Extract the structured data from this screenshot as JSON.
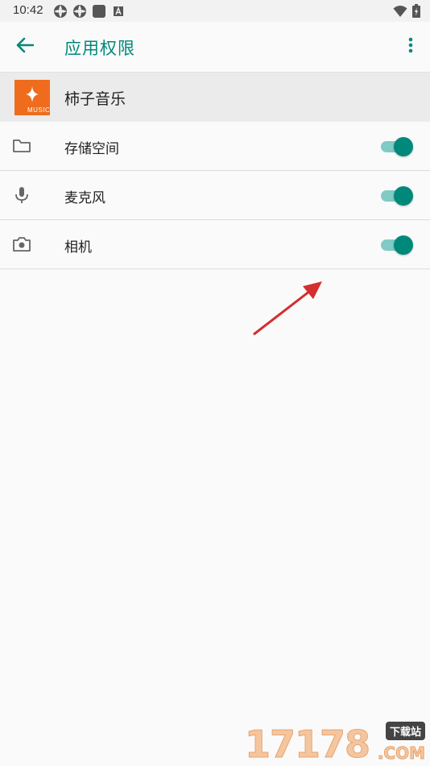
{
  "status_bar": {
    "time": "10:42",
    "left_icons": [
      "sync-icon",
      "sync-icon",
      "square-notification-icon",
      "a-notification-icon"
    ],
    "right_icons": [
      "wifi-icon",
      "battery-charging-icon"
    ]
  },
  "app_bar": {
    "title": "应用权限",
    "back_icon": "arrow-back-icon",
    "more_icon": "more-vert-icon",
    "accent_color": "#00897b"
  },
  "app_header": {
    "name": "柿子音乐",
    "icon_text": "MUSIC",
    "icon_color": "#ef6c1d"
  },
  "permissions": [
    {
      "label": "存储空间",
      "icon": "folder-icon",
      "enabled": true
    },
    {
      "label": "麦克风",
      "icon": "microphone-icon",
      "enabled": true
    },
    {
      "label": "相机",
      "icon": "camera-icon",
      "enabled": true
    }
  ],
  "watermark": {
    "digits": "17178",
    "badge": "下载站",
    "suffix": ".COM"
  }
}
